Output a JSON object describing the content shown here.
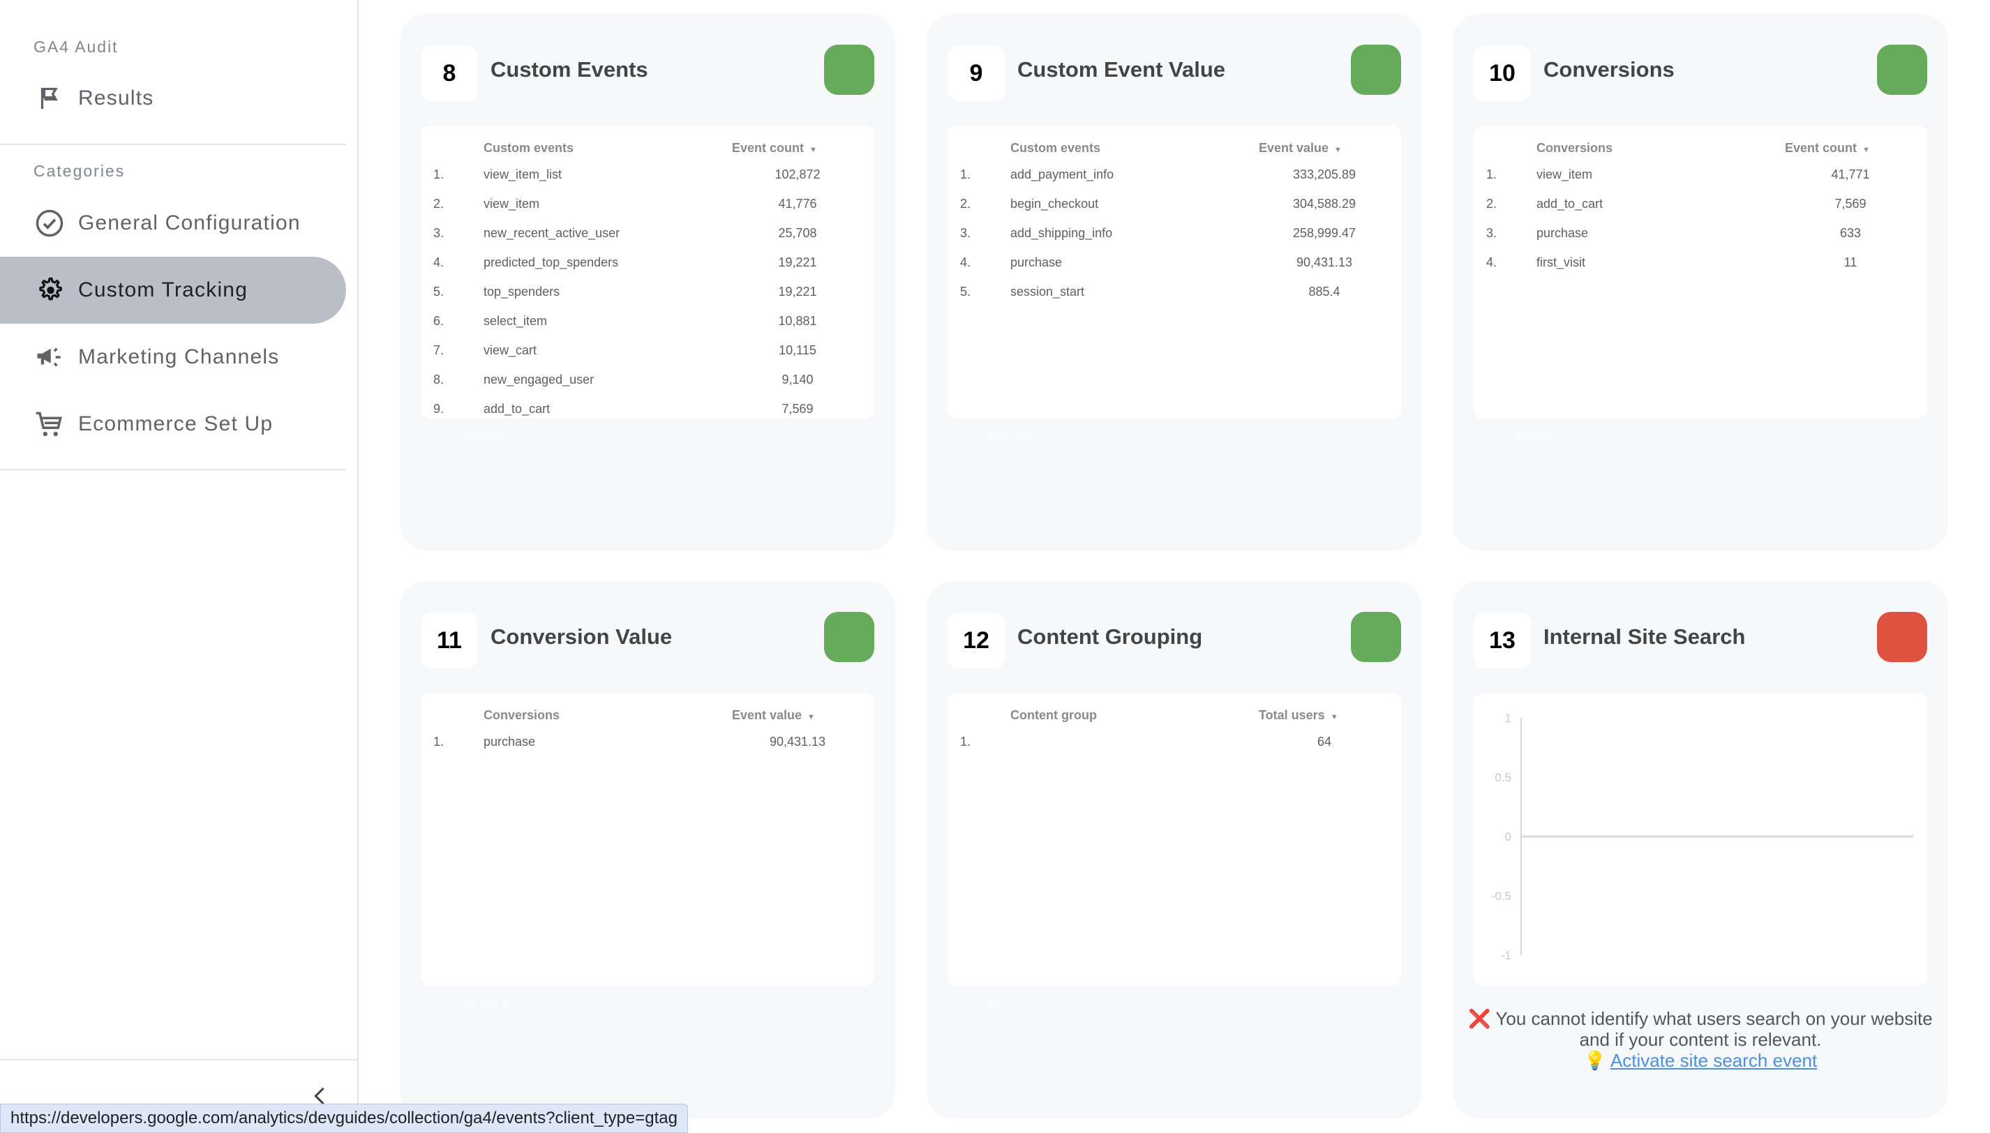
{
  "sidebar": {
    "app_title": "GA4 Audit",
    "results_label": "Results",
    "categories_label": "Categories",
    "items": [
      {
        "label": "General Configuration",
        "icon": "check-circle-icon",
        "active": false
      },
      {
        "label": "Custom Tracking",
        "icon": "gear-icon",
        "active": true
      },
      {
        "label": "Marketing Channels",
        "icon": "megaphone-icon",
        "active": false
      },
      {
        "label": "Ecommerce Set Up",
        "icon": "cart-icon",
        "active": false
      }
    ],
    "collapse_icon": "chevron-left-icon"
  },
  "colors": {
    "status_ok": "#66aa5b",
    "status_fail": "#e05240",
    "active_nav": "#b9bec9",
    "link": "#4a90e2"
  },
  "cards": [
    {
      "number": "8",
      "title": "Custom Events",
      "status": "ok",
      "columns": [
        "Custom events",
        "Event count"
      ],
      "rows": [
        {
          "idx": "1.",
          "name": "view_item_list",
          "value": "102,872"
        },
        {
          "idx": "2.",
          "name": "view_item",
          "value": "41,776"
        },
        {
          "idx": "3.",
          "name": "new_recent_active_user",
          "value": "25,708"
        },
        {
          "idx": "4.",
          "name": "predicted_top_spenders",
          "value": "19,221"
        },
        {
          "idx": "5.",
          "name": "top_spenders",
          "value": "19,221"
        },
        {
          "idx": "6.",
          "name": "select_item",
          "value": "10,881"
        },
        {
          "idx": "7.",
          "name": "view_cart",
          "value": "10,115"
        },
        {
          "idx": "8.",
          "name": "new_engaged_user",
          "value": "9,140"
        },
        {
          "idx": "9.",
          "name": "add_to_cart",
          "value": "7,569"
        }
      ],
      "total": "260,169"
    },
    {
      "number": "9",
      "title": "Custom Event Value",
      "status": "ok",
      "columns": [
        "Custom events",
        "Event value"
      ],
      "rows": [
        {
          "idx": "1.",
          "name": "add_payment_info",
          "value": "333,205.89"
        },
        {
          "idx": "2.",
          "name": "begin_checkout",
          "value": "304,588.29"
        },
        {
          "idx": "3.",
          "name": "add_shipping_info",
          "value": "258,999.47"
        },
        {
          "idx": "4.",
          "name": "purchase",
          "value": "90,431.13"
        },
        {
          "idx": "5.",
          "name": "session_start",
          "value": "885.4"
        }
      ],
      "total": "987,225"
    },
    {
      "number": "10",
      "title": "Conversions",
      "status": "ok",
      "columns": [
        "Conversions",
        "Event count"
      ],
      "rows": [
        {
          "idx": "1.",
          "name": "view_item",
          "value": "41,771"
        },
        {
          "idx": "2.",
          "name": "add_to_cart",
          "value": "7,569"
        },
        {
          "idx": "3.",
          "name": "purchase",
          "value": "633"
        },
        {
          "idx": "4.",
          "name": "first_visit",
          "value": "11"
        }
      ],
      "total": "49,984"
    },
    {
      "number": "11",
      "title": "Conversion Value",
      "status": "ok",
      "columns": [
        "Conversions",
        "Event value"
      ],
      "rows": [
        {
          "idx": "1.",
          "name": "purchase",
          "value": "90,431.13"
        }
      ],
      "total": "90,431.13"
    },
    {
      "number": "12",
      "title": "Content Grouping",
      "status": "ok",
      "columns": [
        "Content group",
        "Total users"
      ],
      "rows": [
        {
          "idx": "1.",
          "name": "",
          "value": "64"
        }
      ],
      "total": "64"
    },
    {
      "number": "13",
      "title": "Internal Site Search",
      "status": "fail",
      "message": {
        "x_icon": "❌",
        "text": "You cannot identify what users search on your website and if your content is relevant.",
        "bulb_icon": "💡",
        "link_text": "Activate site search event"
      }
    }
  ],
  "chart_data": {
    "type": "line",
    "title": "",
    "xlabel": "",
    "ylabel": "",
    "ylim": [
      -1,
      1
    ],
    "yticks": [
      "1",
      "0.5",
      "0",
      "-0.5",
      "-1"
    ],
    "series": [
      {
        "name": "",
        "values": [
          0,
          0
        ]
      }
    ],
    "grid": false
  },
  "status_bar": {
    "url": "https://developers.google.com/analytics/devguides/collection/ga4/events?client_type=gtag"
  }
}
